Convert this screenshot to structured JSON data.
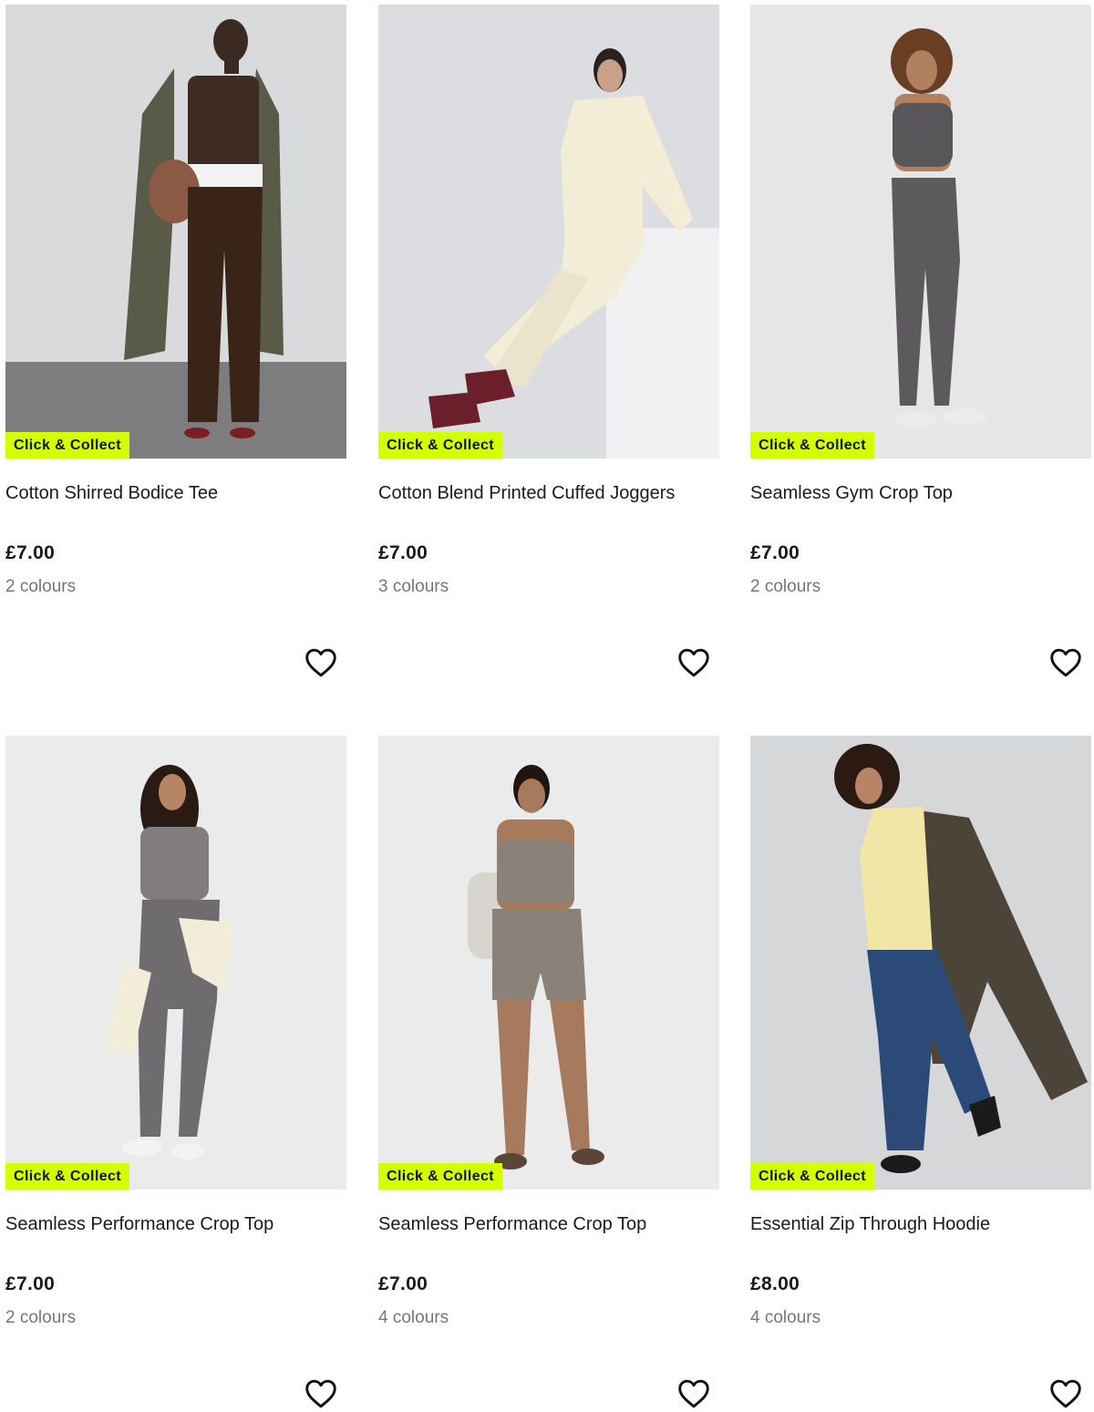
{
  "theme": {
    "badge_color": "#d4ff00",
    "text_color": "#1a1a1a",
    "muted_color": "#767676"
  },
  "products": [
    {
      "title": "Cotton Shirred Bodice Tee",
      "price": "£7.00",
      "colours": "2 colours",
      "badge": "Click & Collect",
      "wishlist_icon": "heart-outline-icon"
    },
    {
      "title": "Cotton Blend Printed Cuffed Joggers",
      "price": "£7.00",
      "colours": "3 colours",
      "badge": "Click & Collect",
      "wishlist_icon": "heart-outline-icon"
    },
    {
      "title": "Seamless Gym Crop Top",
      "price": "£7.00",
      "colours": "2 colours",
      "badge": "Click & Collect",
      "wishlist_icon": "heart-outline-icon"
    },
    {
      "title": "Seamless Performance Crop Top",
      "price": "£7.00",
      "colours": "2 colours",
      "badge": "Click & Collect",
      "wishlist_icon": "heart-outline-icon"
    },
    {
      "title": "Seamless Performance Crop Top",
      "price": "£7.00",
      "colours": "4 colours",
      "badge": "Click & Collect",
      "wishlist_icon": "heart-outline-icon"
    },
    {
      "title": "Essential Zip Through Hoodie",
      "price": "£8.00",
      "colours": "4 colours",
      "badge": "Click & Collect",
      "wishlist_icon": "heart-outline-icon"
    }
  ]
}
